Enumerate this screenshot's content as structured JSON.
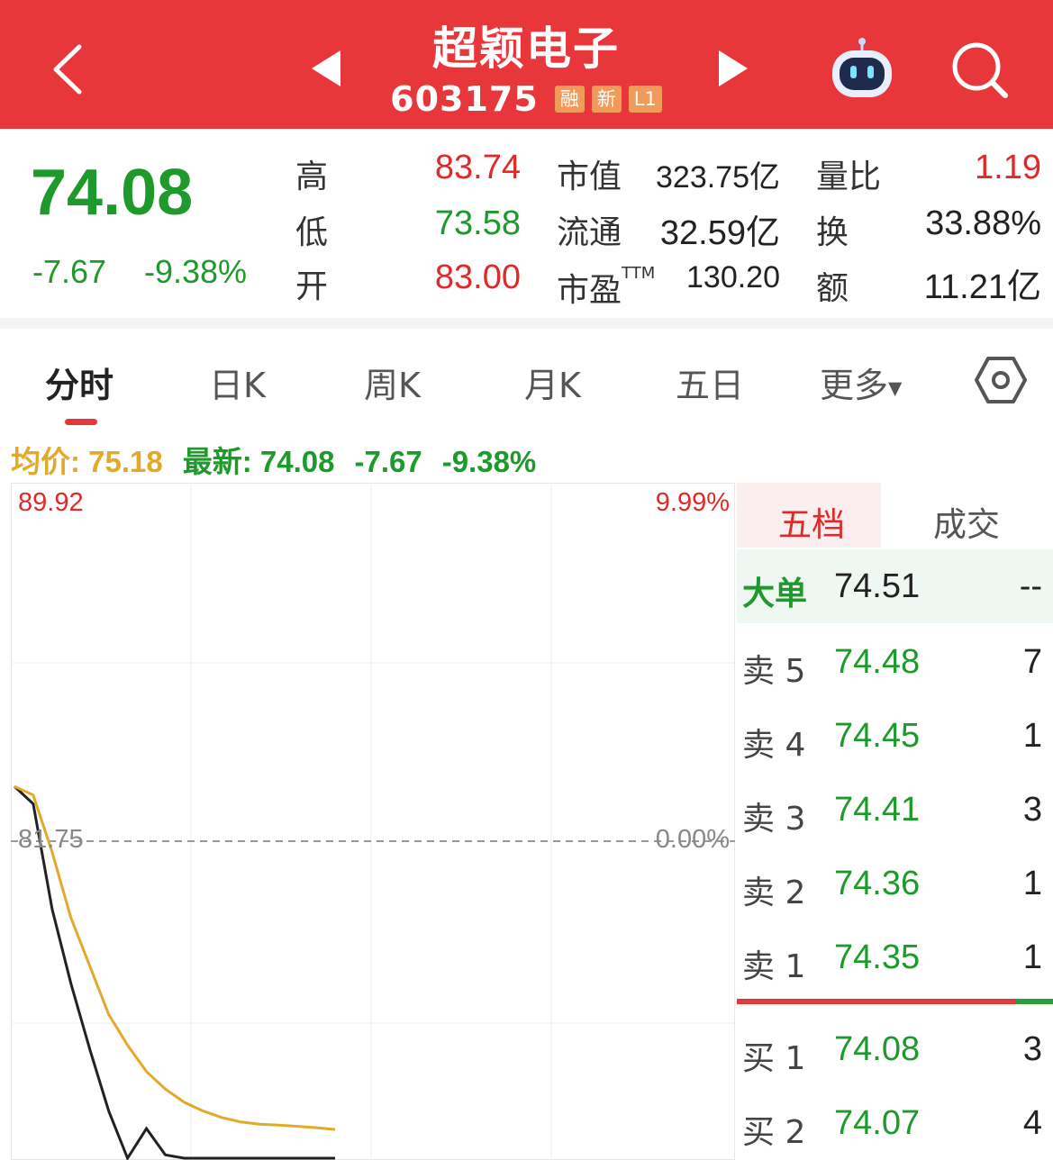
{
  "header": {
    "title": "超颖电子",
    "code": "603175",
    "tags": [
      "融",
      "新",
      "L1"
    ],
    "icons": [
      "back-icon",
      "prev-arrow-icon",
      "next-arrow-icon",
      "robot-icon",
      "search-icon"
    ]
  },
  "quote": {
    "price": "74.08",
    "change": "-7.67",
    "change_pct": "-9.38%",
    "high_label": "高",
    "high": "83.74",
    "low_label": "低",
    "low": "73.58",
    "open_label": "开",
    "open": "83.00",
    "mcap_label": "市值",
    "mcap": "323.75亿",
    "float_label": "流通",
    "float": "32.59亿",
    "pe_label": "市盈",
    "pe_suffix": "TTM",
    "pe": "130.20",
    "vol_ratio_label": "量比",
    "vol_ratio": "1.19",
    "turnover_label": "换",
    "turnover": "33.88%",
    "amount_label": "额",
    "amount": "11.21亿"
  },
  "tabs": {
    "items": [
      "分时",
      "日K",
      "周K",
      "月K",
      "五日",
      "更多"
    ],
    "active": "分时"
  },
  "info": {
    "avg": "均价: 75.18",
    "latest": "最新: 74.08",
    "chg": "-7.67",
    "pct": "-9.38%"
  },
  "chart_data": {
    "type": "line",
    "price_top": "89.92",
    "pct_top": "9.99%",
    "price_mid": "81.75",
    "pct_mid": "0.00%",
    "ylim": [
      73.58,
      89.92
    ],
    "reference": 81.75,
    "series": [
      {
        "color": "#222222",
        "values": [
          83.0,
          82.6,
          80.2,
          78.5,
          77.0,
          75.6,
          74.4,
          75.2,
          74.6,
          73.9,
          73.6,
          74.1,
          74.2,
          74.0,
          74.1,
          74.0,
          74.1,
          74.08
        ]
      },
      {
        "color": "#e2a92a",
        "values": [
          83.0,
          82.8,
          81.5,
          80.0,
          78.9,
          77.8,
          77.1,
          76.5,
          76.1,
          75.8,
          75.6,
          75.45,
          75.35,
          75.3,
          75.28,
          75.25,
          75.22,
          75.18
        ]
      }
    ]
  },
  "book": {
    "tab_active": "五档",
    "tab_inactive": "成交",
    "big_label": "大单",
    "big_price": "74.51",
    "big_vol": "--",
    "asks": [
      {
        "label": "卖 5",
        "price": "74.48",
        "vol": "7"
      },
      {
        "label": "卖 4",
        "price": "74.45",
        "vol": "1"
      },
      {
        "label": "卖 3",
        "price": "74.41",
        "vol": "3"
      },
      {
        "label": "卖 2",
        "price": "74.36",
        "vol": "1"
      },
      {
        "label": "卖 1",
        "price": "74.35",
        "vol": "1"
      }
    ],
    "bids": [
      {
        "label": "买 1",
        "price": "74.08",
        "vol": "3"
      },
      {
        "label": "买 2",
        "price": "74.07",
        "vol": "4"
      }
    ]
  }
}
